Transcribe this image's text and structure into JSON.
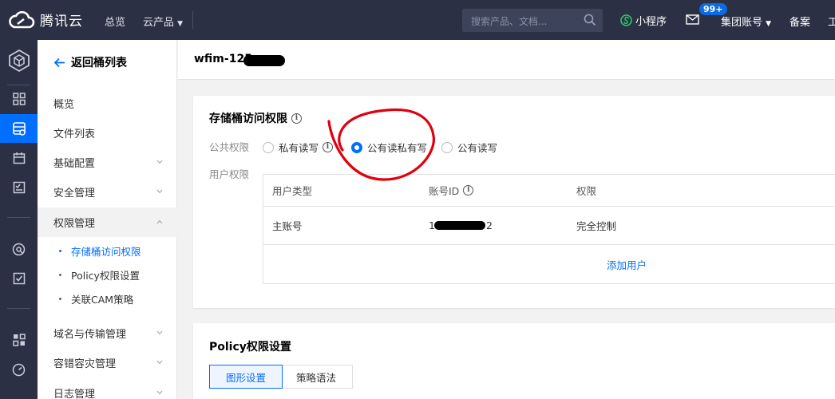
{
  "brand": {
    "name": "腾讯云"
  },
  "topnav": {
    "overview": "总览",
    "products": "云产品",
    "search_placeholder": "搜索产品、文档...",
    "mini_program": "小程序",
    "badge": "99+",
    "group_account": "集团账号",
    "beian": "备案",
    "truncated": "工"
  },
  "sidebar": {
    "back_label": "返回桶列表",
    "items": [
      {
        "label": "概览"
      },
      {
        "label": "文件列表"
      },
      {
        "label": "基础配置"
      },
      {
        "label": "安全管理"
      },
      {
        "label": "权限管理"
      },
      {
        "label": "域名与传输管理"
      },
      {
        "label": "容错容灾管理"
      },
      {
        "label": "日志管理"
      }
    ],
    "sub_items": [
      {
        "label": "存储桶访问权限"
      },
      {
        "label": "Policy权限设置"
      },
      {
        "label": "关联CAM策略"
      }
    ]
  },
  "header": {
    "bucket_name": "wfim-125"
  },
  "access": {
    "title": "存储桶访问权限",
    "public_label": "公共权限",
    "options": [
      {
        "label": "私有读写"
      },
      {
        "label": "公有读私有写"
      },
      {
        "label": "公有读写"
      }
    ],
    "selected": "公有读私有写",
    "user_label": "用户权限",
    "columns": [
      "用户类型",
      "账号ID",
      "权限"
    ],
    "rows": [
      {
        "type": "主账号",
        "account_id": "1",
        "account_id_tail": "2",
        "permission": "完全控制"
      }
    ],
    "add_user": "添加用户"
  },
  "policy": {
    "title": "Policy权限设置",
    "tabs": [
      {
        "label": "图形设置"
      },
      {
        "label": "策略语法"
      }
    ]
  },
  "colors": {
    "topbar": "#2b3044",
    "accent": "#006eff",
    "annotation": "#e0000f"
  }
}
